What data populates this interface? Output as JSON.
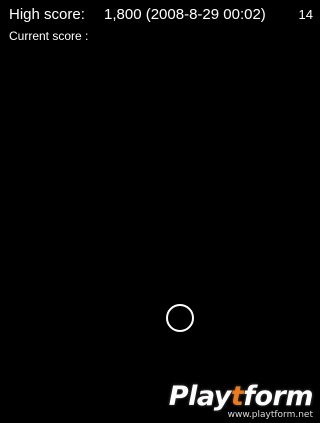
{
  "hud": {
    "high_score_label": "High score:",
    "high_score_value": "1,800 (2008-8-29 00:02)",
    "counter": "14",
    "current_score_label": "Current score :",
    "current_score_value": ""
  },
  "watermark": {
    "logo_pre": "Play",
    "logo_accent": "t",
    "logo_post": "form",
    "url": "www.playtform.net"
  },
  "colors": {
    "background": "#000000",
    "text": "#ffffff",
    "watermark_accent": "#f07a1a"
  },
  "icons": {
    "player": "ring-icon"
  }
}
